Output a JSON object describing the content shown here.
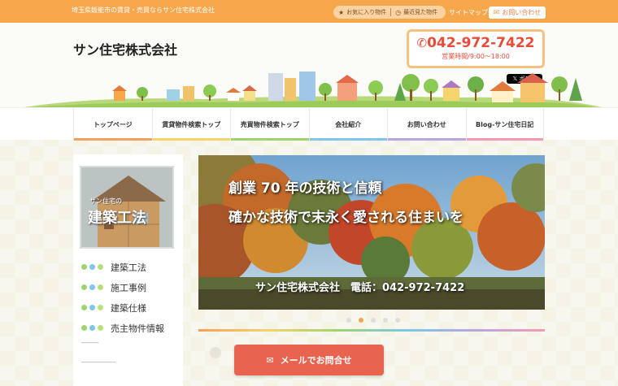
{
  "topbar": {
    "tagline": "埼玉県飯能市の賃貸・売買ならサン住宅株式会社",
    "favorites": "お気に入り物件",
    "recent": "最近見た物件",
    "sitemap": "サイトマップ",
    "contact": "お問い合わせ"
  },
  "header": {
    "company": "サン住宅株式会社",
    "phone": "042-972-7422",
    "hours": "営業時間/9:00～18:00",
    "tweet": "ポスト"
  },
  "nav": {
    "items": [
      {
        "label": "トップページ",
        "color": "#f3a15a"
      },
      {
        "label": "賃貸物件検索トップ",
        "color": "#f6d36b"
      },
      {
        "label": "売買物件検索トップ",
        "color": "#9fd36f"
      },
      {
        "label": "会社紹介",
        "color": "#7cc7e8"
      },
      {
        "label": "お問い合わせ",
        "color": "#b8a6e0"
      },
      {
        "label": "Blog-サン住宅日記",
        "color": "#f39ab7"
      }
    ]
  },
  "sidebar": {
    "banner_sub": "サン住宅の",
    "banner_title": "建築工法",
    "items": [
      {
        "label": "建築工法"
      },
      {
        "label": "施工事例"
      },
      {
        "label": "建築仕様"
      },
      {
        "label": "売主物件情報"
      }
    ],
    "dot_colors": [
      "#9fd36f",
      "#7cc7e8",
      "#b8e07a"
    ]
  },
  "slider": {
    "line1": "創業 70 年の技術と信頼",
    "line2": "確かな技術で末永く愛される住まいを",
    "footer": "サン住宅株式会社　電話：042-972-7422",
    "active_index": 1,
    "count": 5
  },
  "mail_button": {
    "label": "メールでお問合せ"
  },
  "colors": {
    "accent": "#f6a74c",
    "phone": "#e84b39",
    "mail_button": "#e8644e"
  }
}
